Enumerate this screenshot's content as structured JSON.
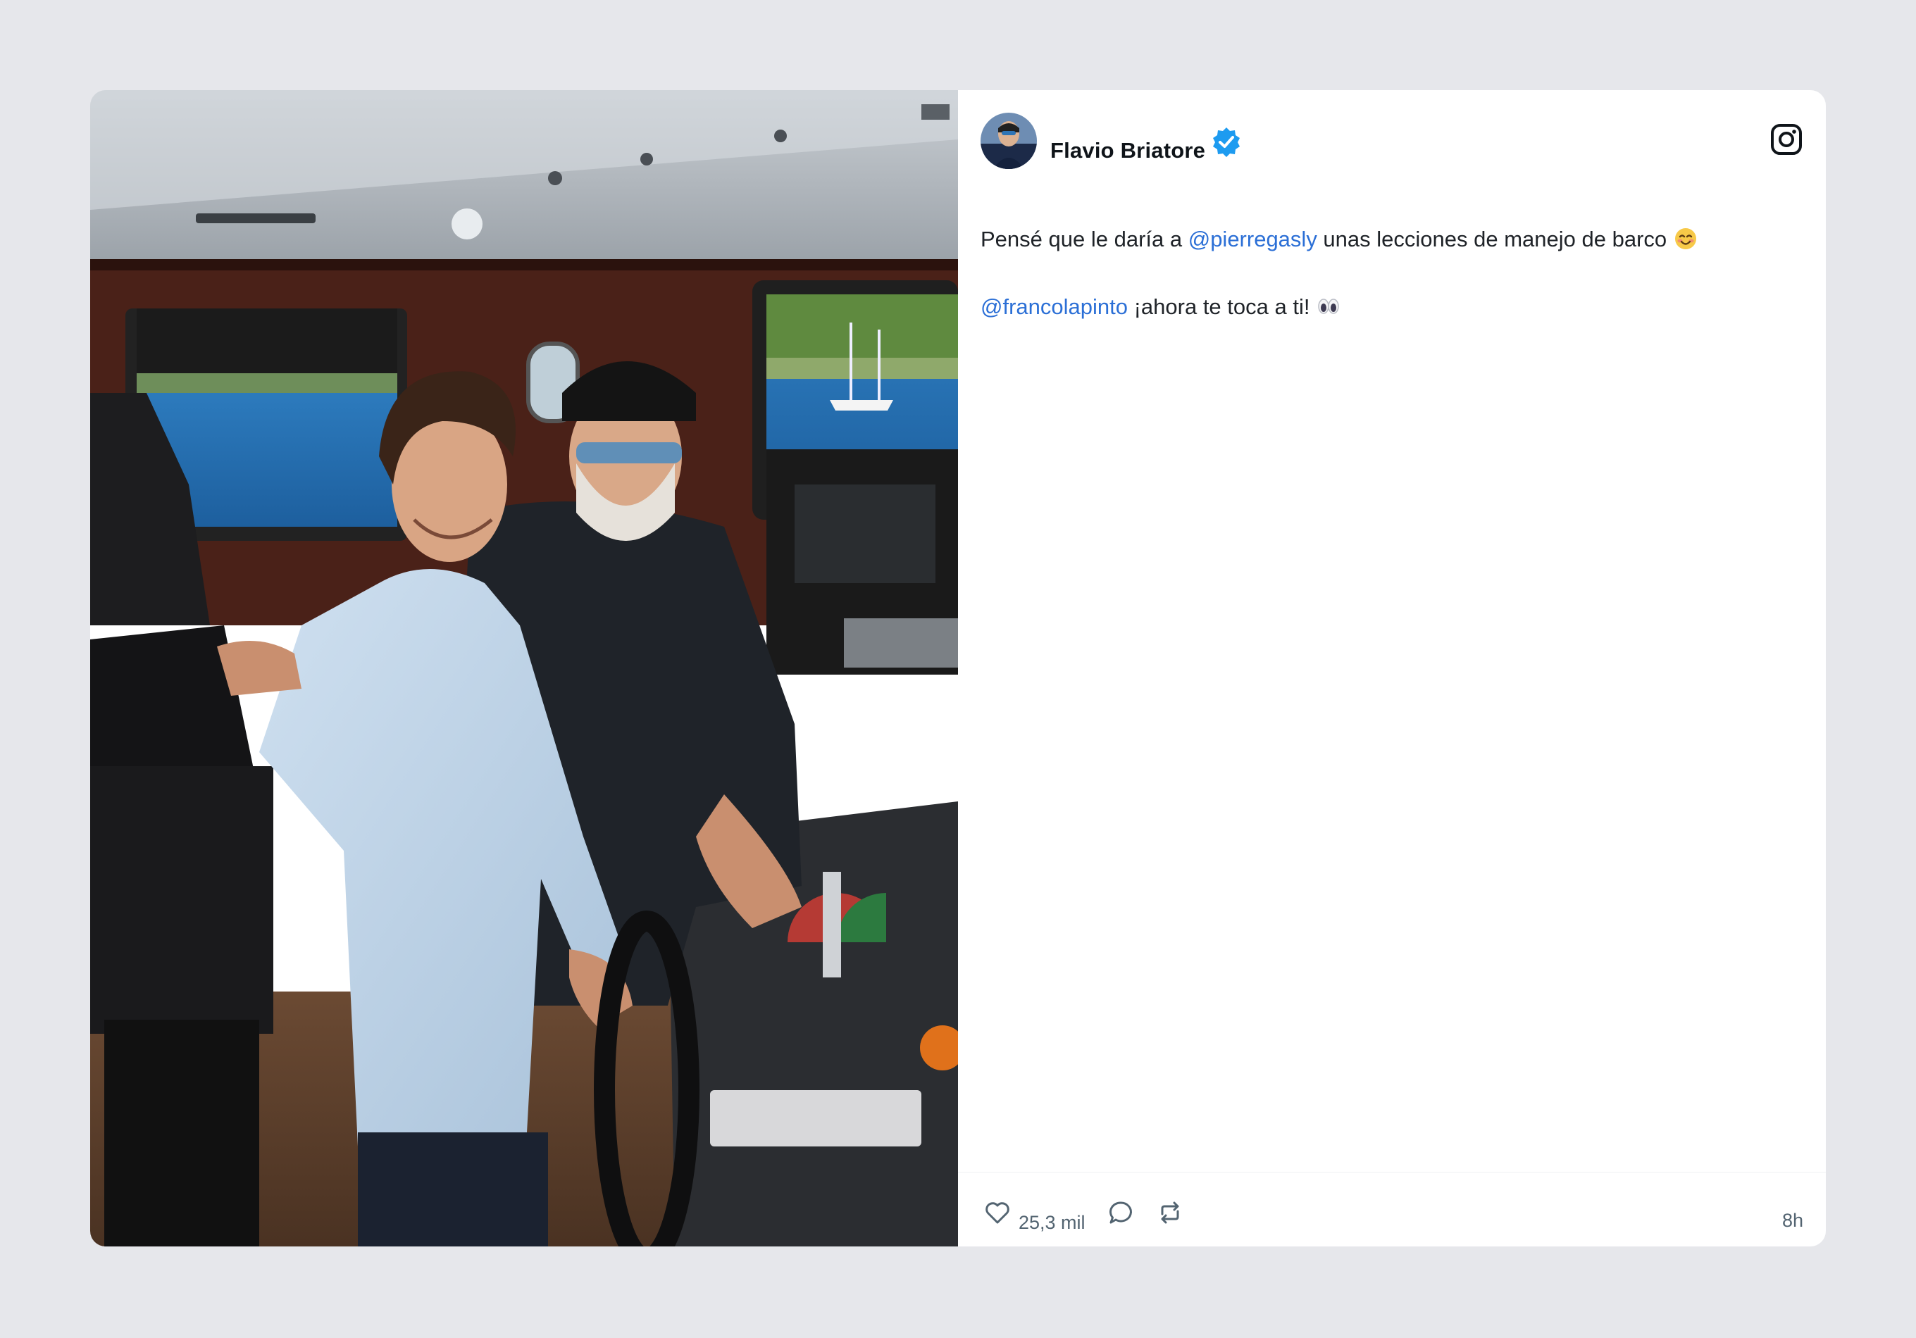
{
  "post": {
    "author_name": "Flavio Briatore",
    "verified": true,
    "platform_icon": "instagram-icon",
    "text": {
      "line1_before": "Pensé que le daría a ",
      "line1_mention": "@pierregasly",
      "line1_after": " unas lecciones de manejo de barco",
      "line1_emoji": "smiling-face-icon",
      "line2_mention": "@francolapinto",
      "line2_after": " ¡ahora te toca a ti!",
      "line2_emoji": "eyes-icon"
    },
    "actions": {
      "like_icon": "heart-icon",
      "like_count": "25,3 mil",
      "comment_icon": "comment-icon",
      "repost_icon": "repost-icon"
    },
    "timestamp": "8h"
  },
  "colors": {
    "page_background": "#e6e7eb",
    "card_background": "#ffffff",
    "mention": "#2b6fd6",
    "verified": "#1d9bf0",
    "muted_text": "#536471"
  }
}
